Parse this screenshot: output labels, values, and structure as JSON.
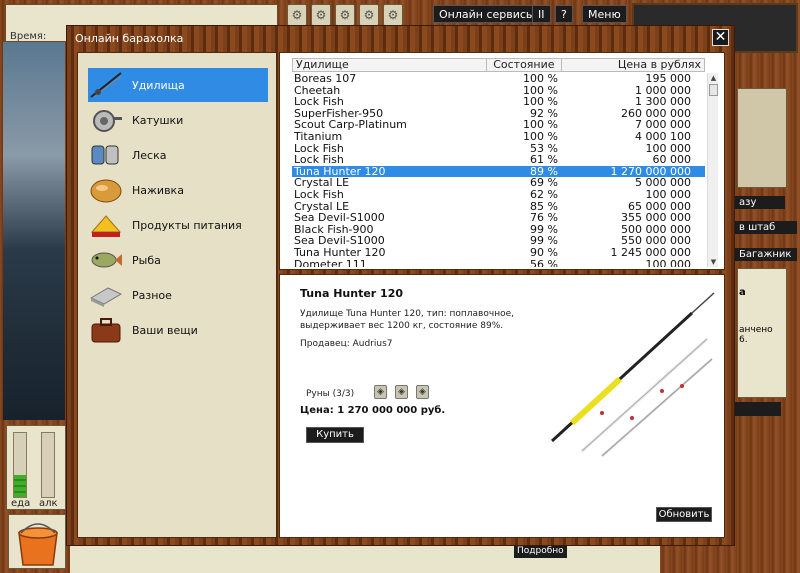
{
  "background": {
    "time_label": "Время:",
    "top_buttons": {
      "online_services": "Онлайн сервисы",
      "pause": "II",
      "help": "?",
      "menu": "Меню"
    },
    "side_buttons": [
      "азу",
      "в штаб",
      "Багажник"
    ],
    "side_texts": [
      "а",
      "анчено",
      "6."
    ],
    "gauges": [
      {
        "label": "еда",
        "level": 0.35
      },
      {
        "label": "алк",
        "level": 0.0
      }
    ],
    "details_button": "Подробно"
  },
  "modal": {
    "title": "Онлайн барахолка",
    "close_glyph": "✕",
    "categories": [
      {
        "label": "Удилища",
        "icon": "fishing-rod-icon",
        "active": true
      },
      {
        "label": "Катушки",
        "icon": "reel-icon",
        "active": false
      },
      {
        "label": "Леска",
        "icon": "fishing-line-icon",
        "active": false
      },
      {
        "label": "Наживка",
        "icon": "bait-icon",
        "active": false
      },
      {
        "label": "Продукты питания",
        "icon": "food-icon",
        "active": false
      },
      {
        "label": "Рыба",
        "icon": "fish-icon",
        "active": false
      },
      {
        "label": "Разное",
        "icon": "misc-icon",
        "active": false
      },
      {
        "label": "Ваши вещи",
        "icon": "briefcase-icon",
        "active": false
      }
    ],
    "table": {
      "columns": [
        "Удилище",
        "Состояние",
        "Цена в рублях"
      ],
      "rows": [
        {
          "name": "Boreas 107",
          "state": "100 %",
          "price": "195 000"
        },
        {
          "name": "Cheetah",
          "state": "100 %",
          "price": "1 000 000"
        },
        {
          "name": "Lock Fish",
          "state": "100 %",
          "price": "1 300 000"
        },
        {
          "name": "SuperFisher-950",
          "state": "92 %",
          "price": "260 000 000"
        },
        {
          "name": "Scout Carp-Platinum",
          "state": "100 %",
          "price": "7 000 000"
        },
        {
          "name": "Titanium",
          "state": "100 %",
          "price": "4 000 100"
        },
        {
          "name": "Lock Fish",
          "state": "53 %",
          "price": "100 000"
        },
        {
          "name": "Lock Fish",
          "state": "61 %",
          "price": "60 000"
        },
        {
          "name": "Tuna Hunter 120",
          "state": "89 %",
          "price": "1 270 000 000",
          "selected": true
        },
        {
          "name": "Crystal LE",
          "state": "69 %",
          "price": "5 000 000"
        },
        {
          "name": "Lock Fish",
          "state": "62 %",
          "price": "100 000"
        },
        {
          "name": "Crystal LE",
          "state": "85 %",
          "price": "65 000 000"
        },
        {
          "name": "Sea Devil-S1000",
          "state": "76 %",
          "price": "355 000 000"
        },
        {
          "name": "Black Fish-900",
          "state": "99 %",
          "price": "500 000 000"
        },
        {
          "name": "Sea Devil-S1000",
          "state": "99 %",
          "price": "550 000 000"
        },
        {
          "name": "Tuna Hunter 120",
          "state": "90 %",
          "price": "1 245 000 000"
        },
        {
          "name": "Dometer 111",
          "state": "56 %",
          "price": "100 000"
        }
      ]
    },
    "detail": {
      "title": "Tuna Hunter 120",
      "description": "Удилище Tuna Hunter 120, тип: поплавочное, выдерживает вес 1200 кг, состояние 89%.",
      "seller": "Продавец: Audrius7",
      "runes": "Руны (3/3)",
      "price": "Цена: 1 270 000 000 руб.",
      "buy_label": "Купить",
      "refresh_label": "Обновить"
    }
  }
}
